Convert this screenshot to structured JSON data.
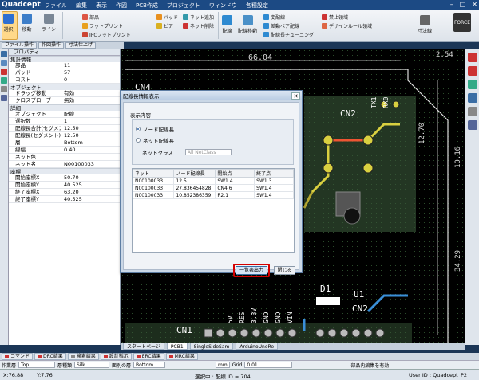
{
  "app": {
    "title": "Quadcept",
    "menu": [
      "ファイル",
      "編集",
      "表示",
      "作図",
      "PCB作成",
      "プロジェクト",
      "ウィンドウ",
      "各種設定"
    ],
    "window_controls": [
      "–",
      "□",
      "✕"
    ]
  },
  "ribbon": {
    "select": "選択",
    "move": "移動",
    "line": "ライン",
    "parts": "部品",
    "footprint": "フットプリント",
    "ipc_footprint": "IPCフットプリント",
    "pad": "パッド",
    "via": "ビア",
    "net_add": "ネット追加",
    "net_delete": "ネット削除",
    "wiring": "配線",
    "wire_move": "配線移動",
    "change_wiring": "変配線",
    "diff_pair": "差動ペア配線",
    "wire_tuning": "配線長チューニング",
    "forbid_area": "禁止領域",
    "design_rule": "デザインルール領域",
    "dimension": "寸法線",
    "force": "FORCE"
  },
  "top_tabs": [
    "ファイル操作",
    "作図操作",
    "寸法仕上げ"
  ],
  "properties": {
    "title": "プロパティ",
    "categories": [
      {
        "name": "集計情報",
        "rows": [
          [
            "部品",
            "11"
          ],
          [
            "パッド",
            "57"
          ],
          [
            "コスト",
            "0"
          ]
        ]
      },
      {
        "name": "オブジェクト",
        "rows": [
          [
            "ドラッグ移動",
            "有効"
          ],
          [
            "クロスプローブ",
            "無効"
          ]
        ]
      },
      {
        "name": "詳細",
        "rows": [
          [
            "オブジェクト",
            "配線"
          ],
          [
            "選択数",
            "1"
          ],
          [
            "配線長合計(セグメント)",
            "12.50"
          ],
          [
            "配線長(セグメント)",
            "12.50"
          ],
          [
            "層",
            "Bottom"
          ],
          [
            "線幅",
            "0.40"
          ],
          [
            "ネット色",
            ""
          ],
          [
            "ネット名",
            "N00100033"
          ]
        ]
      },
      {
        "name": "座標",
        "rows": [
          [
            "開始座標X",
            "50.70"
          ],
          [
            "開始座標Y",
            "40.525"
          ],
          [
            "終了座標X",
            "63.20"
          ],
          [
            "終了座標Y",
            "40.525"
          ]
        ]
      }
    ]
  },
  "pcb": {
    "dims": [
      "66.04",
      "2.54",
      "12.70",
      "10.16",
      "34.29"
    ],
    "labels": [
      "CN2",
      "TX1",
      "RX0",
      "CN4",
      "D1",
      "U1",
      "CN1",
      "CN2",
      "5V",
      "RES",
      "3.3V",
      "GND",
      "GND",
      "VIN"
    ]
  },
  "dialog": {
    "title": "配線長情報表示",
    "section_label": "表示内容",
    "radio_node": "ノード配線長",
    "radio_net": "ネット配線長",
    "net_class_label": "ネットクラス",
    "net_class_value": "All NetClass",
    "columns": [
      "ネット",
      "ノード配線長",
      "開始点",
      "終了点"
    ],
    "rows": [
      [
        "N00100033",
        "12.5",
        "SW1.4",
        "SW1.3"
      ],
      [
        "N00100033",
        "27.836454828",
        "CN4.6",
        "SW1.4"
      ],
      [
        "N00100033",
        "10.852386359",
        "R2.1",
        "SW1.4"
      ]
    ],
    "export_button": "一覧表出力",
    "close_button": "閉じる"
  },
  "doc_tabs": [
    "スタートページ",
    "PCB1",
    "SingleSideSam",
    "ArduinoUnoRe"
  ],
  "bottom_tabs": [
    "コマンド",
    "DRC結果",
    "検索結果",
    "設計指示",
    "ERC結果",
    "MRC結果"
  ],
  "layerbar": {
    "work_layer_label": "作業層",
    "work_layer": "Top",
    "drill_label": "層種類",
    "drill_value": "Silk",
    "display_label": "面別の層",
    "display_value": "Bottom",
    "unit": "mm",
    "grid_label": "Grid",
    "grid_value": "0.01",
    "check_label": "部品内編集を有効"
  },
  "status": {
    "x": "X:76.88",
    "y": "Y:7.76",
    "mode": "選択中 : 配線 ID = 704",
    "user": "User ID : Quadcept_P2"
  }
}
